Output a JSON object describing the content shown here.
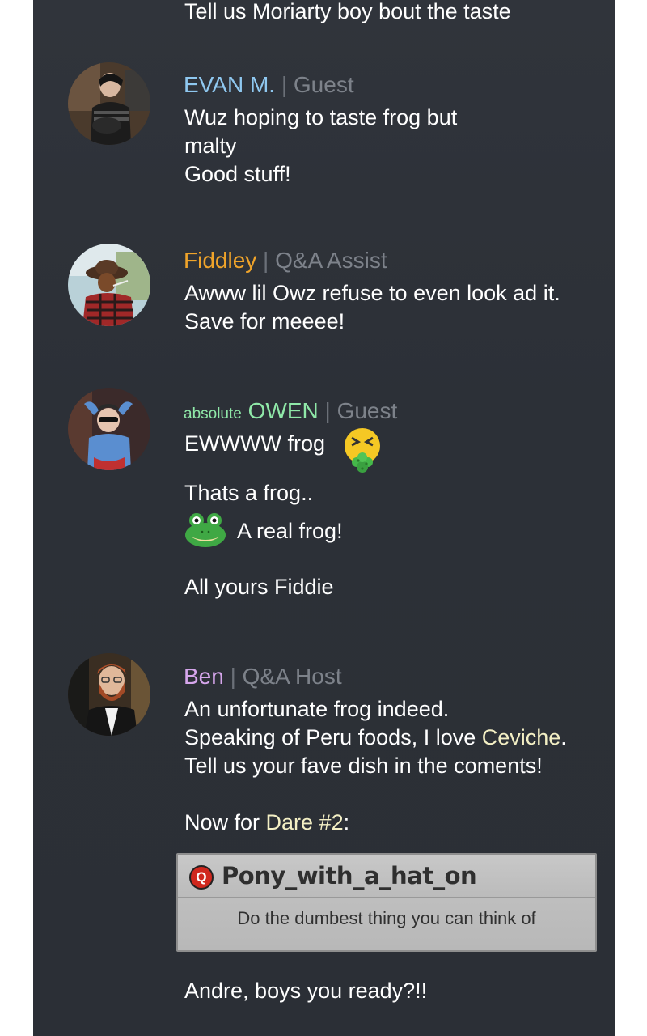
{
  "top_line": "Tell us Moriarty boy bout the taste",
  "messages": [
    {
      "name": "EVAN M.",
      "role": "Guest",
      "name_color": "#8fc8f0",
      "lines": [
        "Wuz hoping to taste frog but",
        "malty",
        "Good stuff!"
      ]
    },
    {
      "name": "Fiddley",
      "role": "Q&A Assist",
      "name_color": "#f0a42a",
      "lines": [
        "Awww lil Owz refuse to even look ad it.",
        "Save for meeee!"
      ]
    },
    {
      "prefix": "absolute",
      "name": "OWEN",
      "role": "Guest",
      "name_color": "#8fe8a8",
      "lines": [
        "EWWWW frog",
        "Thats a frog..",
        "A real frog!",
        "All yours Fiddie"
      ],
      "icons": [
        "nauseated-face-emoji",
        "frog-emoji"
      ]
    },
    {
      "name": "Ben",
      "role": "Q&A Host",
      "name_color": "#d6a6ec",
      "lines": [
        "An unfortunate frog indeed.",
        "Speaking of Peru foods, I love ",
        "Ceviche",
        ".",
        "Tell us your fave dish in the coments!",
        "Now for ",
        "Dare #2",
        ":",
        "Andre, boys you ready?!!"
      ]
    }
  ],
  "question_card": {
    "icon": "Q",
    "username": "Pony_with_a_hat_on",
    "text": "Do the dumbest thing you can think of"
  },
  "separator": "|"
}
